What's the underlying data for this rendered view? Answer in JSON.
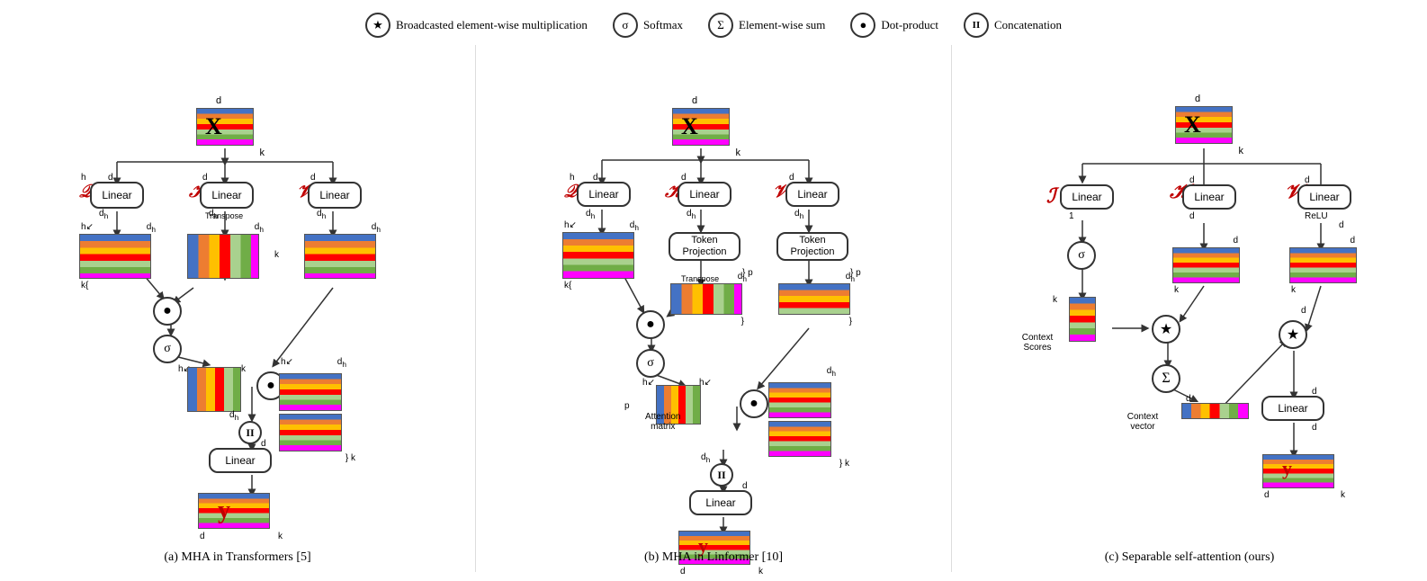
{
  "legend": {
    "items": [
      {
        "symbol": "★",
        "label": "Broadcasted element-wise multiplication"
      },
      {
        "symbol": "σ",
        "label": "Softmax"
      },
      {
        "symbol": "Σ",
        "label": "Element-wise sum"
      },
      {
        "symbol": "●",
        "label": "Dot-product"
      },
      {
        "symbol": "||",
        "label": "Concatenation"
      }
    ]
  },
  "diagrams": [
    {
      "id": "a",
      "caption": "(a) MHA in Transformers [5]"
    },
    {
      "id": "b",
      "caption": "(b) MHA in Linformer [10]"
    },
    {
      "id": "c",
      "caption": "(c) Separable self-attention (ours)"
    }
  ],
  "colors": {
    "accent": "#C00000",
    "blue_ref": "#0000CC"
  }
}
